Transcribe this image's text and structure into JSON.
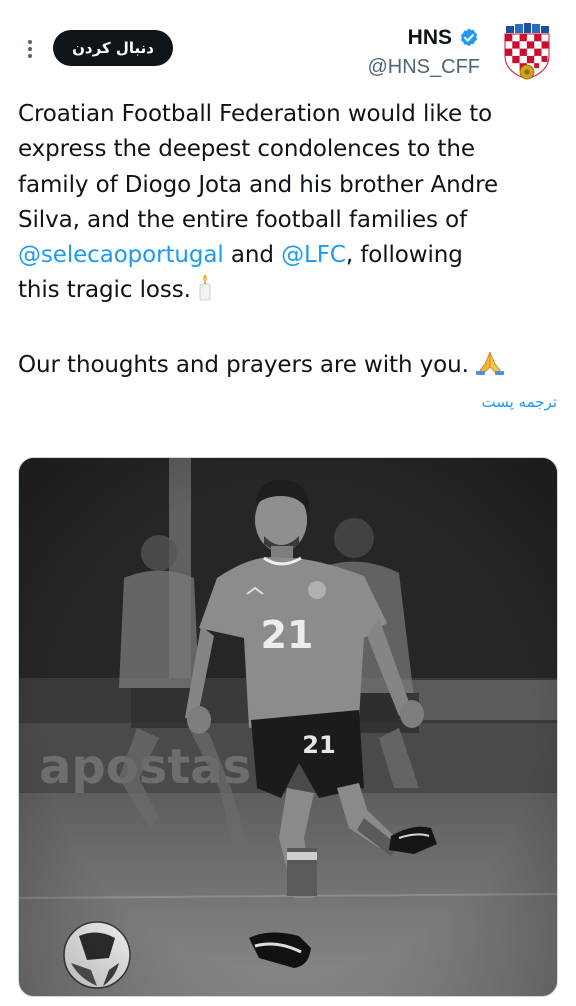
{
  "header": {
    "display_name": "HNS",
    "handle": "@HNS_CFF",
    "follow_label": "دنبال کردن",
    "verified_color": "#1d9bf0",
    "more_icon": "more-vertical-icon",
    "avatar_icon": "croatia-crest-icon"
  },
  "tweet": {
    "lines": [
      "Croatian Football Federation would like to",
      "express the deepest condolences to the",
      "family of Diogo Jota and his brother Andre",
      "Silva, and the entire football families of"
    ],
    "mention_1": "@selecaoportugal",
    "and_text": " and ",
    "mention_2": "@LFC",
    "after_mentions": ", following",
    "line_6": "this tragic loss.",
    "candle_icon": "candle-icon",
    "line_7": "Our thoughts and prayers are with you.",
    "pray_icon": "folded-hands-icon",
    "mention_color": "#1d9bf0"
  },
  "translate_label": "ترجمه پست",
  "photo": {
    "jersey_number": "21",
    "shorts_number": "21",
    "style": "black-and-white"
  }
}
